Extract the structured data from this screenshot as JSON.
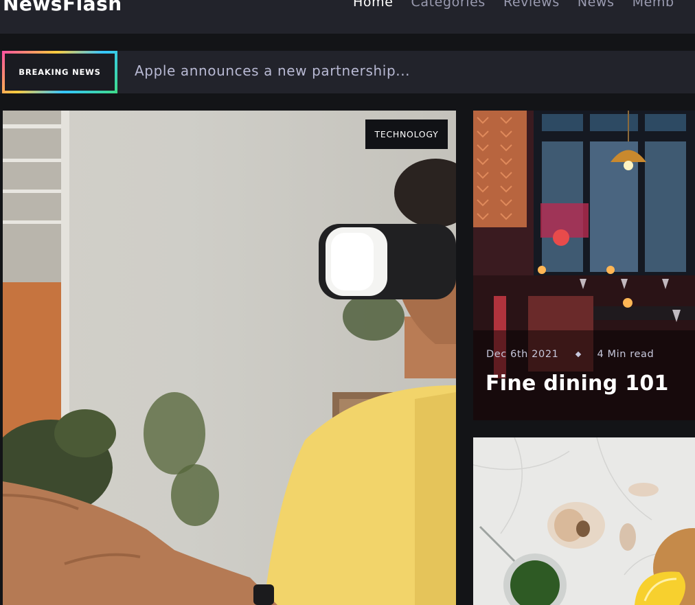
{
  "header": {
    "brand": "NewsFlash",
    "nav": [
      {
        "label": "Home",
        "active": true
      },
      {
        "label": "Categories",
        "active": false
      },
      {
        "label": "Reviews",
        "active": false
      },
      {
        "label": "News",
        "active": false
      },
      {
        "label": "Memb",
        "active": false
      }
    ]
  },
  "breaking": {
    "badge": "BREAKING NEWS",
    "ticker": "Apple announces a new partnership..."
  },
  "feature": {
    "category": "TECHNOLOGY"
  },
  "side_cards": [
    {
      "date": "Dec 6th 2021",
      "read_time": "4 Min read",
      "title": "Fine dining 101"
    }
  ],
  "colors": {
    "background": "#131417",
    "bar": "#22232b",
    "accent_gradient": [
      "#ff4fa3",
      "#ffcb3d",
      "#35c6ff",
      "#3fdc86"
    ]
  }
}
